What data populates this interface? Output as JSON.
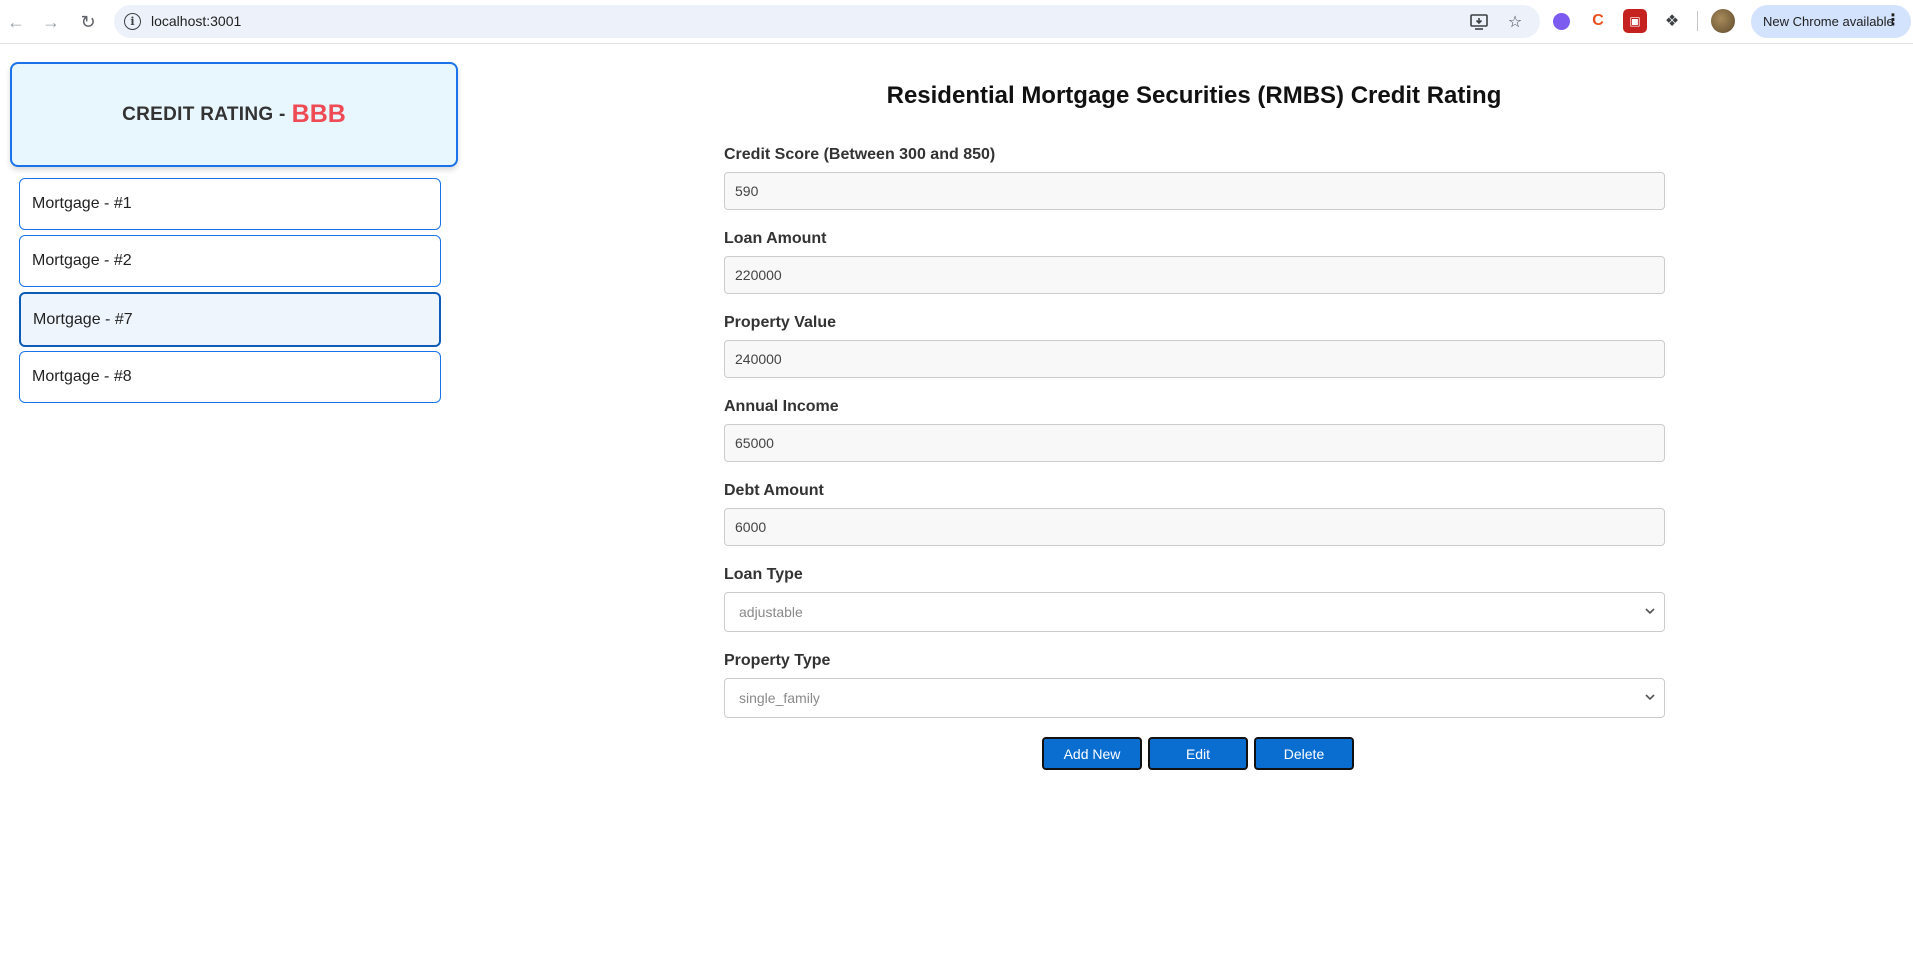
{
  "browser": {
    "url": "localhost:3001",
    "update_label": "New Chrome available",
    "icons": [
      "back-icon",
      "forward-icon",
      "reload-icon",
      "site-info-icon",
      "install-app-icon",
      "bookmark-star-icon",
      "extensions-icon",
      "menu-dots-icon"
    ]
  },
  "sidebar": {
    "rating_label": "CREDIT RATING - ",
    "rating_value": "BBB",
    "rating_color": "#ef4b55",
    "mortgages": [
      {
        "label": "Mortgage - #1",
        "selected": false
      },
      {
        "label": "Mortgage - #2",
        "selected": false
      },
      {
        "label": "Mortgage - #7",
        "selected": true
      },
      {
        "label": "Mortgage - #8",
        "selected": false
      }
    ]
  },
  "main": {
    "title": "Residential Mortgage Securities (RMBS) Credit Rating",
    "fields": {
      "credit_score": {
        "label": "Credit Score (Between 300 and 850)",
        "value": "590"
      },
      "loan_amount": {
        "label": "Loan Amount",
        "value": "220000"
      },
      "property_value": {
        "label": "Property Value",
        "value": "240000"
      },
      "annual_income": {
        "label": "Annual Income",
        "value": "65000"
      },
      "debt_amount": {
        "label": "Debt Amount",
        "value": "6000"
      },
      "loan_type": {
        "label": "Loan Type",
        "value": "adjustable"
      },
      "property_type": {
        "label": "Property Type",
        "value": "single_family"
      }
    },
    "buttons": {
      "add": "Add New",
      "edit": "Edit",
      "delete": "Delete"
    },
    "accent_color": "#0a6ed1"
  }
}
